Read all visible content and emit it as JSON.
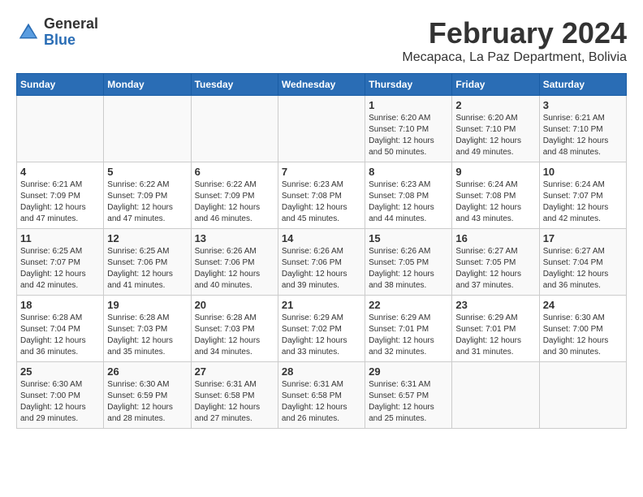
{
  "header": {
    "logo_general": "General",
    "logo_blue": "Blue",
    "month_title": "February 2024",
    "subtitle": "Mecapaca, La Paz Department, Bolivia"
  },
  "days_of_week": [
    "Sunday",
    "Monday",
    "Tuesday",
    "Wednesday",
    "Thursday",
    "Friday",
    "Saturday"
  ],
  "weeks": [
    [
      {
        "day": "",
        "info": ""
      },
      {
        "day": "",
        "info": ""
      },
      {
        "day": "",
        "info": ""
      },
      {
        "day": "",
        "info": ""
      },
      {
        "day": "1",
        "info": "Sunrise: 6:20 AM\nSunset: 7:10 PM\nDaylight: 12 hours\nand 50 minutes."
      },
      {
        "day": "2",
        "info": "Sunrise: 6:20 AM\nSunset: 7:10 PM\nDaylight: 12 hours\nand 49 minutes."
      },
      {
        "day": "3",
        "info": "Sunrise: 6:21 AM\nSunset: 7:10 PM\nDaylight: 12 hours\nand 48 minutes."
      }
    ],
    [
      {
        "day": "4",
        "info": "Sunrise: 6:21 AM\nSunset: 7:09 PM\nDaylight: 12 hours\nand 47 minutes."
      },
      {
        "day": "5",
        "info": "Sunrise: 6:22 AM\nSunset: 7:09 PM\nDaylight: 12 hours\nand 47 minutes."
      },
      {
        "day": "6",
        "info": "Sunrise: 6:22 AM\nSunset: 7:09 PM\nDaylight: 12 hours\nand 46 minutes."
      },
      {
        "day": "7",
        "info": "Sunrise: 6:23 AM\nSunset: 7:08 PM\nDaylight: 12 hours\nand 45 minutes."
      },
      {
        "day": "8",
        "info": "Sunrise: 6:23 AM\nSunset: 7:08 PM\nDaylight: 12 hours\nand 44 minutes."
      },
      {
        "day": "9",
        "info": "Sunrise: 6:24 AM\nSunset: 7:08 PM\nDaylight: 12 hours\nand 43 minutes."
      },
      {
        "day": "10",
        "info": "Sunrise: 6:24 AM\nSunset: 7:07 PM\nDaylight: 12 hours\nand 42 minutes."
      }
    ],
    [
      {
        "day": "11",
        "info": "Sunrise: 6:25 AM\nSunset: 7:07 PM\nDaylight: 12 hours\nand 42 minutes."
      },
      {
        "day": "12",
        "info": "Sunrise: 6:25 AM\nSunset: 7:06 PM\nDaylight: 12 hours\nand 41 minutes."
      },
      {
        "day": "13",
        "info": "Sunrise: 6:26 AM\nSunset: 7:06 PM\nDaylight: 12 hours\nand 40 minutes."
      },
      {
        "day": "14",
        "info": "Sunrise: 6:26 AM\nSunset: 7:06 PM\nDaylight: 12 hours\nand 39 minutes."
      },
      {
        "day": "15",
        "info": "Sunrise: 6:26 AM\nSunset: 7:05 PM\nDaylight: 12 hours\nand 38 minutes."
      },
      {
        "day": "16",
        "info": "Sunrise: 6:27 AM\nSunset: 7:05 PM\nDaylight: 12 hours\nand 37 minutes."
      },
      {
        "day": "17",
        "info": "Sunrise: 6:27 AM\nSunset: 7:04 PM\nDaylight: 12 hours\nand 36 minutes."
      }
    ],
    [
      {
        "day": "18",
        "info": "Sunrise: 6:28 AM\nSunset: 7:04 PM\nDaylight: 12 hours\nand 36 minutes."
      },
      {
        "day": "19",
        "info": "Sunrise: 6:28 AM\nSunset: 7:03 PM\nDaylight: 12 hours\nand 35 minutes."
      },
      {
        "day": "20",
        "info": "Sunrise: 6:28 AM\nSunset: 7:03 PM\nDaylight: 12 hours\nand 34 minutes."
      },
      {
        "day": "21",
        "info": "Sunrise: 6:29 AM\nSunset: 7:02 PM\nDaylight: 12 hours\nand 33 minutes."
      },
      {
        "day": "22",
        "info": "Sunrise: 6:29 AM\nSunset: 7:01 PM\nDaylight: 12 hours\nand 32 minutes."
      },
      {
        "day": "23",
        "info": "Sunrise: 6:29 AM\nSunset: 7:01 PM\nDaylight: 12 hours\nand 31 minutes."
      },
      {
        "day": "24",
        "info": "Sunrise: 6:30 AM\nSunset: 7:00 PM\nDaylight: 12 hours\nand 30 minutes."
      }
    ],
    [
      {
        "day": "25",
        "info": "Sunrise: 6:30 AM\nSunset: 7:00 PM\nDaylight: 12 hours\nand 29 minutes."
      },
      {
        "day": "26",
        "info": "Sunrise: 6:30 AM\nSunset: 6:59 PM\nDaylight: 12 hours\nand 28 minutes."
      },
      {
        "day": "27",
        "info": "Sunrise: 6:31 AM\nSunset: 6:58 PM\nDaylight: 12 hours\nand 27 minutes."
      },
      {
        "day": "28",
        "info": "Sunrise: 6:31 AM\nSunset: 6:58 PM\nDaylight: 12 hours\nand 26 minutes."
      },
      {
        "day": "29",
        "info": "Sunrise: 6:31 AM\nSunset: 6:57 PM\nDaylight: 12 hours\nand 25 minutes."
      },
      {
        "day": "",
        "info": ""
      },
      {
        "day": "",
        "info": ""
      }
    ]
  ]
}
